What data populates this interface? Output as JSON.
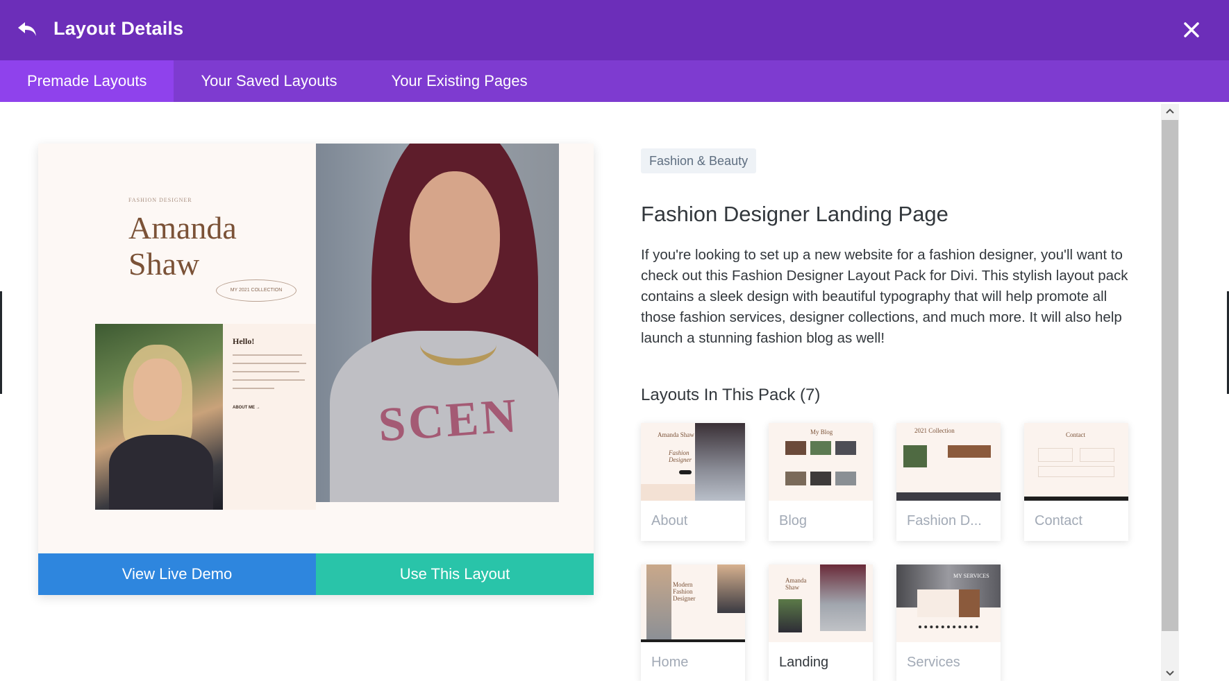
{
  "header": {
    "title": "Layout Details",
    "back_icon": "undo-arrow-icon",
    "close_icon": "close-icon",
    "background": "#6c2eb9"
  },
  "tabs": [
    {
      "label": "Premade Layouts",
      "active": true
    },
    {
      "label": "Your Saved Layouts",
      "active": false
    },
    {
      "label": "Your Existing Pages",
      "active": false
    }
  ],
  "preview": {
    "small_caption": "FASHION DESIGNER",
    "name_line1": "Amanda",
    "name_line2": "Shaw",
    "collection_pill": "MY 2021 COLLECTION",
    "hello_title": "Hello!",
    "about_link": "ABOUT ME →",
    "shirt_print": "SCEN",
    "demo_button": "View Live Demo",
    "use_button": "Use This Layout",
    "demo_color": "#2e86de",
    "use_color": "#29c4a9"
  },
  "details": {
    "category": "Fashion & Beauty",
    "title": "Fashion Designer Landing Page",
    "description": "If you're looking to set up a new website for a fashion designer, you'll want to check out this Fashion Designer Layout Pack for Divi. This stylish layout pack contains a sleek design with beautiful typography that will help promote all those fashion services, designer collections, and much more. It will also help launch a stunning fashion blog as well!",
    "pack_title": "Layouts In This Pack (7)"
  },
  "pack_layouts": [
    {
      "label": "About",
      "active": false
    },
    {
      "label": "Blog",
      "active": false
    },
    {
      "label": "Fashion D...",
      "active": false
    },
    {
      "label": "Contact",
      "active": false
    },
    {
      "label": "Home",
      "active": false
    },
    {
      "label": "Landing",
      "active": true
    },
    {
      "label": "Services",
      "active": false
    }
  ],
  "thumb_text": {
    "about": "Amanda Shaw",
    "about_sub": "Fashion Designer",
    "blog": "My Blog",
    "collection": "2021 Collection",
    "contact": "Contact",
    "home": "Modern Fashion Designer",
    "landing": "Amanda Shaw",
    "services": "MY SERVICES"
  }
}
